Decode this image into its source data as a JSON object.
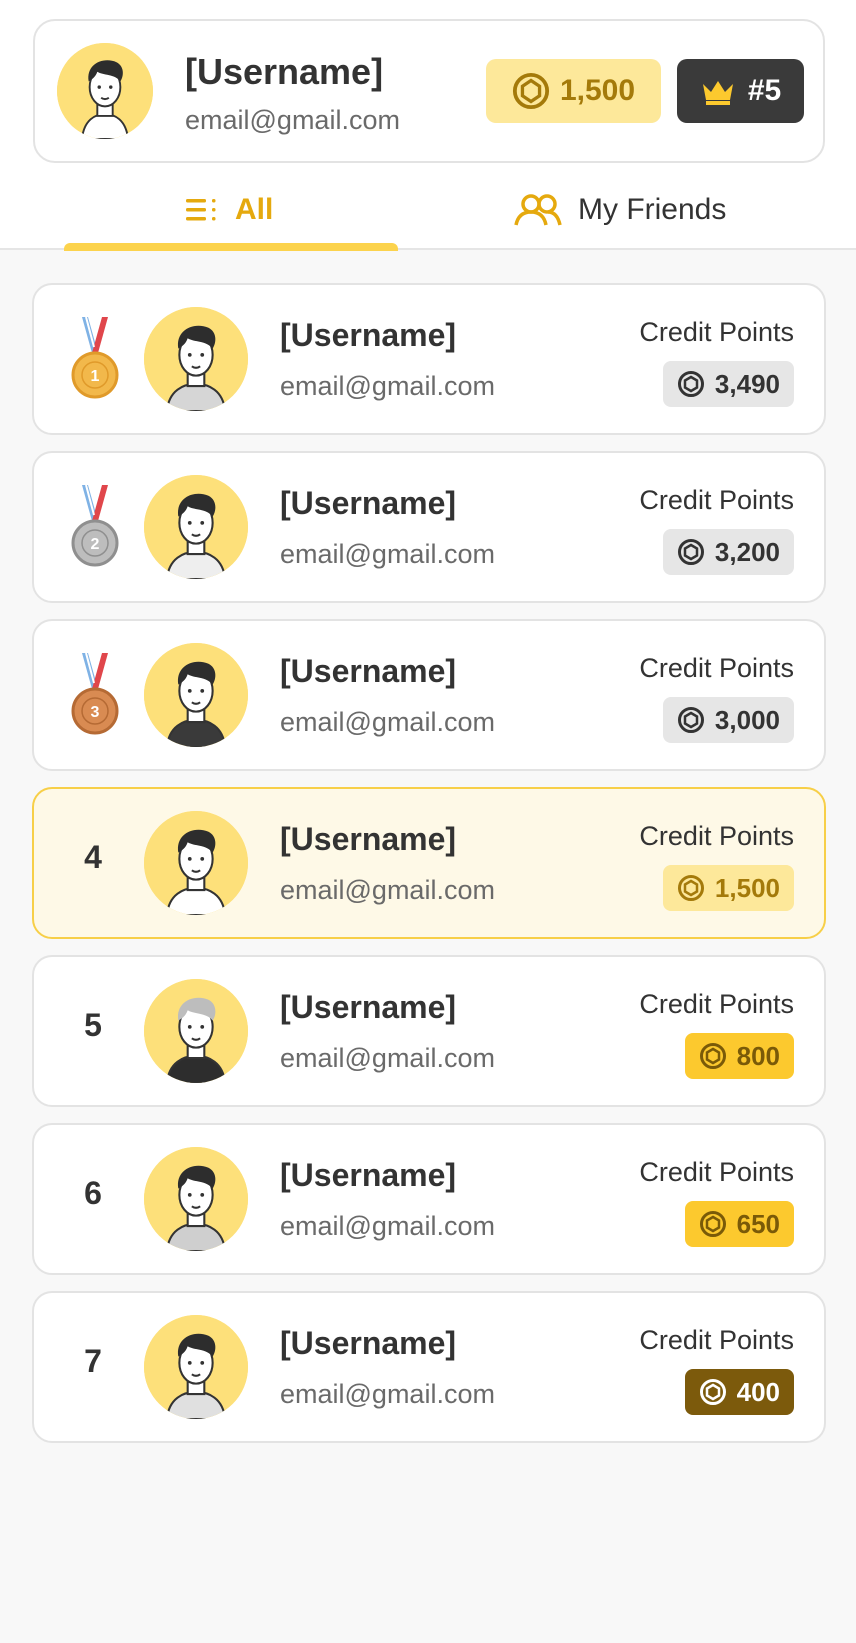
{
  "profile": {
    "name": "[Username]",
    "email": "email@gmail.com",
    "coins": "1,500",
    "rank": "#5"
  },
  "tabs": [
    {
      "label": "All",
      "icon": "list-icon",
      "active": true
    },
    {
      "label": "My Friends",
      "icon": "friends-icon",
      "active": false
    }
  ],
  "leaderboard": [
    {
      "rank": "1",
      "medal": "gold",
      "name": "[Username]",
      "email": "email@gmail.com",
      "label": "Credit Points",
      "points": "3,490",
      "tier": "gray"
    },
    {
      "rank": "2",
      "medal": "silver",
      "name": "[Username]",
      "email": "email@gmail.com",
      "label": "Credit Points",
      "points": "3,200",
      "tier": "gray"
    },
    {
      "rank": "3",
      "medal": "bronze",
      "name": "[Username]",
      "email": "email@gmail.com",
      "label": "Credit Points",
      "points": "3,000",
      "tier": "gray"
    },
    {
      "rank": "4",
      "medal": null,
      "name": "[Username]",
      "email": "email@gmail.com",
      "label": "Credit Points",
      "points": "1,500",
      "tier": "lightyellow",
      "current": true
    },
    {
      "rank": "5",
      "medal": null,
      "name": "[Username]",
      "email": "email@gmail.com",
      "label": "Credit Points",
      "points": "800",
      "tier": "yellow"
    },
    {
      "rank": "6",
      "medal": null,
      "name": "[Username]",
      "email": "email@gmail.com",
      "label": "Credit Points",
      "points": "650",
      "tier": "yellow"
    },
    {
      "rank": "7",
      "medal": null,
      "name": "[Username]",
      "email": "email@gmail.com",
      "label": "Credit Points",
      "points": "400",
      "tier": "brown"
    }
  ],
  "colors": {
    "accent": "#e5a90e",
    "avatar_bg": "#fde07a",
    "current_row_bg": "#fef9e7",
    "current_row_border": "#f7cf48"
  }
}
